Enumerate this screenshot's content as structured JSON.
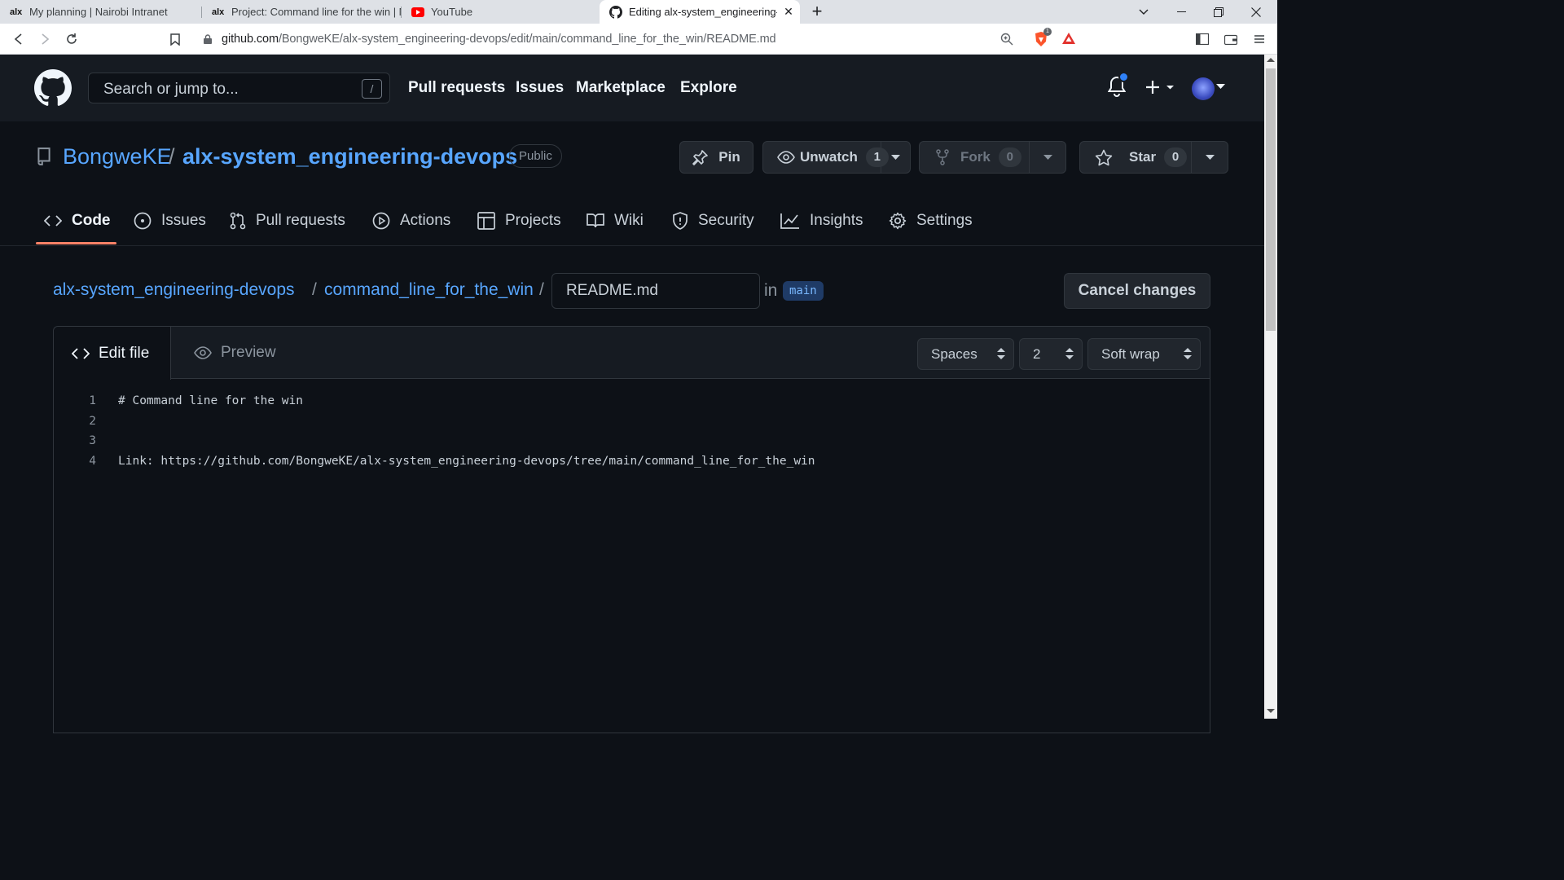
{
  "browser": {
    "tabs": [
      {
        "favicon": "alx-favicon",
        "title": "My planning | Nairobi Intranet"
      },
      {
        "favicon": "alx-favicon",
        "title": "Project: Command line for the win | N"
      },
      {
        "favicon": "youtube-favicon",
        "title": "YouTube"
      },
      {
        "favicon": "github-favicon",
        "title": "Editing alx-system_engineering-d"
      }
    ],
    "url_host": "github.com",
    "url_path": "/BongweKE/alx-system_engineering-devops/edit/main/command_line_for_the_win/README.md",
    "brave_badge": "1"
  },
  "gh_header": {
    "search_placeholder": "Search or jump to...",
    "search_shortcut": "/",
    "nav": [
      "Pull requests",
      "Issues",
      "Marketplace",
      "Explore"
    ]
  },
  "repo": {
    "owner": "BongweKE",
    "separator": "/",
    "name": "alx-system_engineering-devops",
    "visibility": "Public",
    "pin_label": "Pin",
    "unwatch_label": "Unwatch",
    "watch_count": "1",
    "fork_label": "Fork",
    "fork_count": "0",
    "star_label": "Star",
    "star_count": "0"
  },
  "repo_tabs": [
    "Code",
    "Issues",
    "Pull requests",
    "Actions",
    "Projects",
    "Wiki",
    "Security",
    "Insights",
    "Settings"
  ],
  "breadcrumb": {
    "repo": "alx-system_engineering-devops",
    "sep": "/",
    "folder": "command_line_for_the_win",
    "filename": "README.md",
    "in_label": "in",
    "branch": "main",
    "cancel_label": "Cancel changes"
  },
  "editor": {
    "edit_tab": "Edit file",
    "preview_tab": "Preview",
    "indent_mode": "Spaces",
    "indent_size": "2",
    "wrap_mode": "Soft wrap",
    "lines": [
      {
        "n": "1",
        "text": "# Command line for the win"
      },
      {
        "n": "2",
        "text": ""
      },
      {
        "n": "3",
        "text": ""
      },
      {
        "n": "4",
        "text": "Link: https://github.com/BongweKE/alx-system_engineering-devops/tree/main/command_line_for_the_win"
      }
    ]
  },
  "colors": {
    "accent_blue": "#58a6ff",
    "tab_underline": "#f78166",
    "background": "#0d1117"
  }
}
